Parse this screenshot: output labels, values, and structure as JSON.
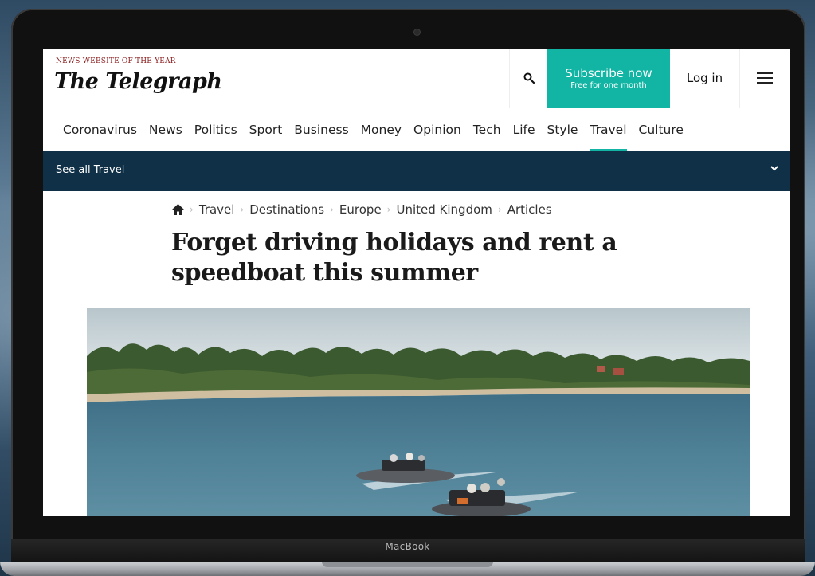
{
  "device": {
    "label": "MacBook"
  },
  "site": {
    "tagline": "NEWS WEBSITE OF THE YEAR",
    "logo": "The Telegraph"
  },
  "header": {
    "search_icon": "search-icon",
    "subscribe_label": "Subscribe now",
    "subscribe_sub": "Free for one month",
    "login_label": "Log in",
    "menu_icon": "hamburger-menu-icon"
  },
  "nav": {
    "items": [
      {
        "label": "Coronavirus"
      },
      {
        "label": "News"
      },
      {
        "label": "Politics"
      },
      {
        "label": "Sport"
      },
      {
        "label": "Business"
      },
      {
        "label": "Money"
      },
      {
        "label": "Opinion"
      },
      {
        "label": "Tech"
      },
      {
        "label": "Life"
      },
      {
        "label": "Style"
      },
      {
        "label": "Travel"
      },
      {
        "label": "Culture"
      }
    ],
    "active": "Travel"
  },
  "subnav": {
    "label": "See all Travel",
    "chevron": "chevron-down-icon"
  },
  "breadcrumb": {
    "home_icon": "home-icon",
    "items": [
      "Travel",
      "Destinations",
      "Europe",
      "United Kingdom",
      "Articles"
    ]
  },
  "article": {
    "headline": "Forget driving holidays and rent a speedboat this summer"
  },
  "colors": {
    "accent": "#12b5a3",
    "subbar": "#0f3046",
    "tagline": "#8a1d1d"
  }
}
